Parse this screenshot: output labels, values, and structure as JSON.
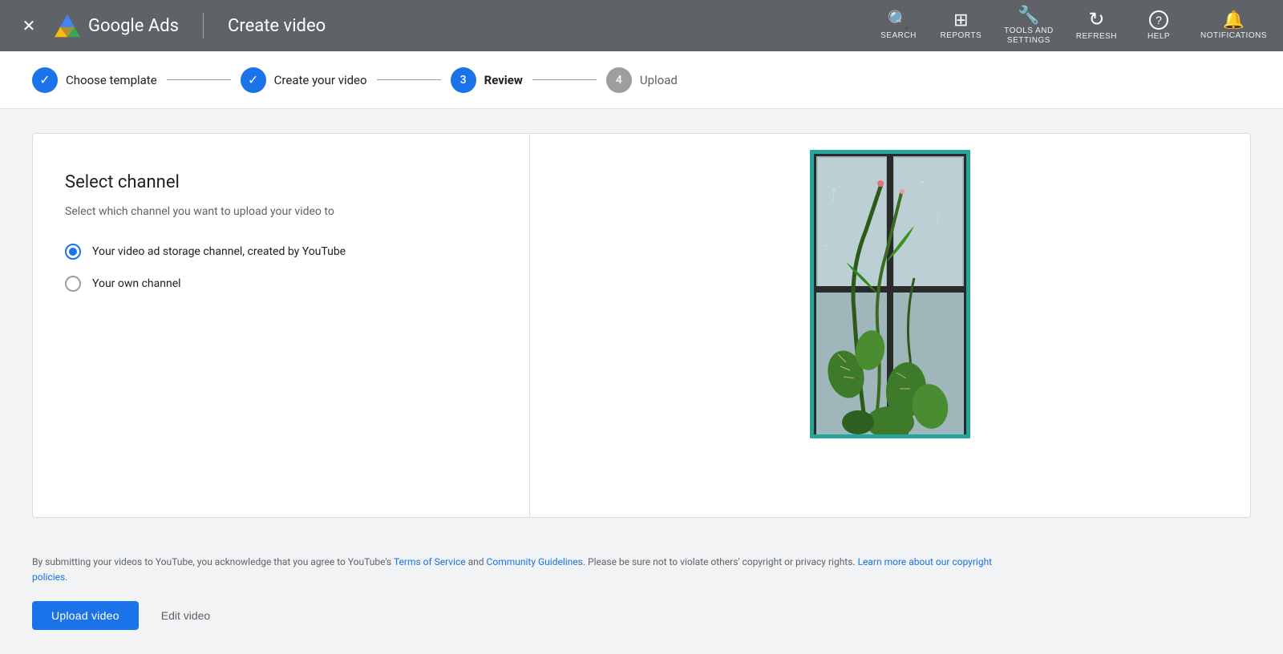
{
  "header": {
    "close_label": "✕",
    "app_name": "Google Ads",
    "divider": true,
    "page_title": "Create video",
    "nav_items": [
      {
        "id": "search",
        "icon": "🔍",
        "label": "SEARCH"
      },
      {
        "id": "reports",
        "icon": "📊",
        "label": "REPORTS"
      },
      {
        "id": "tools",
        "icon": "🔧",
        "label": "TOOLS AND\nSETTINGS"
      },
      {
        "id": "refresh",
        "icon": "↻",
        "label": "REFRESH"
      },
      {
        "id": "help",
        "icon": "?",
        "label": "HELP"
      },
      {
        "id": "notifications",
        "icon": "🔔",
        "label": "NOTIFICATIONS"
      }
    ]
  },
  "stepper": {
    "steps": [
      {
        "id": "choose-template",
        "number": "✓",
        "label": "Choose template",
        "state": "completed"
      },
      {
        "id": "create-video",
        "number": "✓",
        "label": "Create your video",
        "state": "completed"
      },
      {
        "id": "review",
        "number": "3",
        "label": "Review",
        "state": "active"
      },
      {
        "id": "upload",
        "number": "4",
        "label": "Upload",
        "state": "inactive"
      }
    ]
  },
  "main": {
    "section_title": "Select channel",
    "section_subtitle": "Select which channel you want to upload your video to",
    "radio_options": [
      {
        "id": "storage-channel",
        "label": "Your video ad storage channel, created by YouTube",
        "selected": true
      },
      {
        "id": "own-channel",
        "label": "Your own channel",
        "selected": false
      }
    ]
  },
  "footer": {
    "legal_text_1": "By submitting your videos to YouTube, you acknowledge that you agree to YouTube's ",
    "terms_of_service": "Terms of Service",
    "legal_text_2": " and ",
    "community_guidelines": "Community Guidelines",
    "legal_text_3": ". Please be sure not to violate others' copyright or privacy rights. ",
    "learn_more": "Learn more about our copyright policies.",
    "upload_button": "Upload video",
    "edit_button": "Edit video"
  },
  "colors": {
    "primary": "#1a73e8",
    "header_bg": "#5f6368",
    "completed_step": "#1a73e8",
    "active_step": "#1a73e8",
    "inactive_step": "#9e9e9e",
    "preview_bg": "#4db6ac"
  }
}
